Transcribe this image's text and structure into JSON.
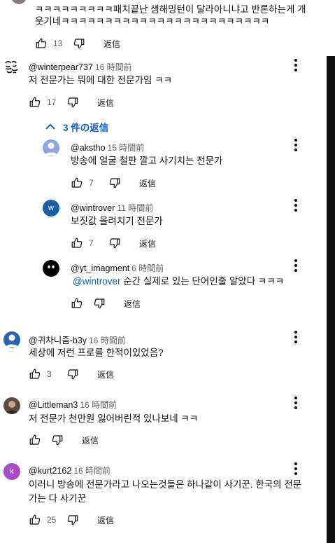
{
  "top_comment": {
    "text_line1": "ㅋㅋㅋㅋㅋㅋㅋㅋㅋ패치끝난 샘해밍턴이 달라아니냐고 반론하는게 개",
    "text_line2": "웃기네ㅋㅋㅋㅋㅋㅋㅋㅋㅋㅋㅋㅋㅋㅋㅋㅋㅋㅋㅋㅋㅋㅋㅋㅋ",
    "likes": "13",
    "reply_label": "返信"
  },
  "comments": [
    {
      "author": "@winterpear737",
      "time": "16 時間前",
      "text": "저 전문가는 뭐에 대한 전문가임 ㅋㅋ",
      "likes": "17",
      "reply_label": "返信",
      "replies_toggle": "3 件の返信",
      "replies": [
        {
          "author": "@akstho",
          "time": "15 時間前",
          "text": "방송에 얼굴 철판 깔고 사기치는 전문가",
          "likes": "7",
          "reply_label": "返信"
        },
        {
          "author": "@wintrover",
          "time": "11 時間前",
          "text": "보짓값 올려치기 전문가",
          "likes": "7",
          "reply_label": "返信",
          "avatar_letter": "w"
        },
        {
          "author": "@yt_imagment",
          "time": "6 時間前",
          "mention": "@wintrover",
          "text": " 순간 실제로 있는 단어인줄 알았다 ㅋㅋㅋ",
          "likes": "",
          "reply_label": "返信"
        }
      ]
    },
    {
      "author": "@귀차니즘-b3y",
      "time": "16 時間前",
      "text": "세상에 저런 프로를 한적이있었음?",
      "likes": "3",
      "reply_label": "返信"
    },
    {
      "author": "@Littleman3",
      "time": "16 時間前",
      "text": "저 전문가 천만원 잃어버린적 있나보네 ㅋㅋ",
      "likes": "",
      "reply_label": "返信"
    },
    {
      "author": "@kurt2162",
      "time": "16 時間前",
      "text_line1": "이러니 방송에 전문가라고 나오는것들은 하나같이 사기꾼. 한국의 전문",
      "text_line2": "가는 다 사기꾼",
      "likes": "25",
      "reply_label": "返信",
      "avatar_letter": "k"
    }
  ],
  "colors": {
    "link_blue": "#065fd4",
    "meta_gray": "#606060",
    "text": "#0f0f0f",
    "wintrover_avatar": "#1a5fa8",
    "kurt_avatar": "#a74bc7",
    "akstho_avatar": "#8ba6e0",
    "gwichanism_avatar": "#2a63b0"
  },
  "icons": [
    "thumb-up-icon",
    "thumb-down-icon",
    "more-vert-icon",
    "chevron-up-icon"
  ]
}
